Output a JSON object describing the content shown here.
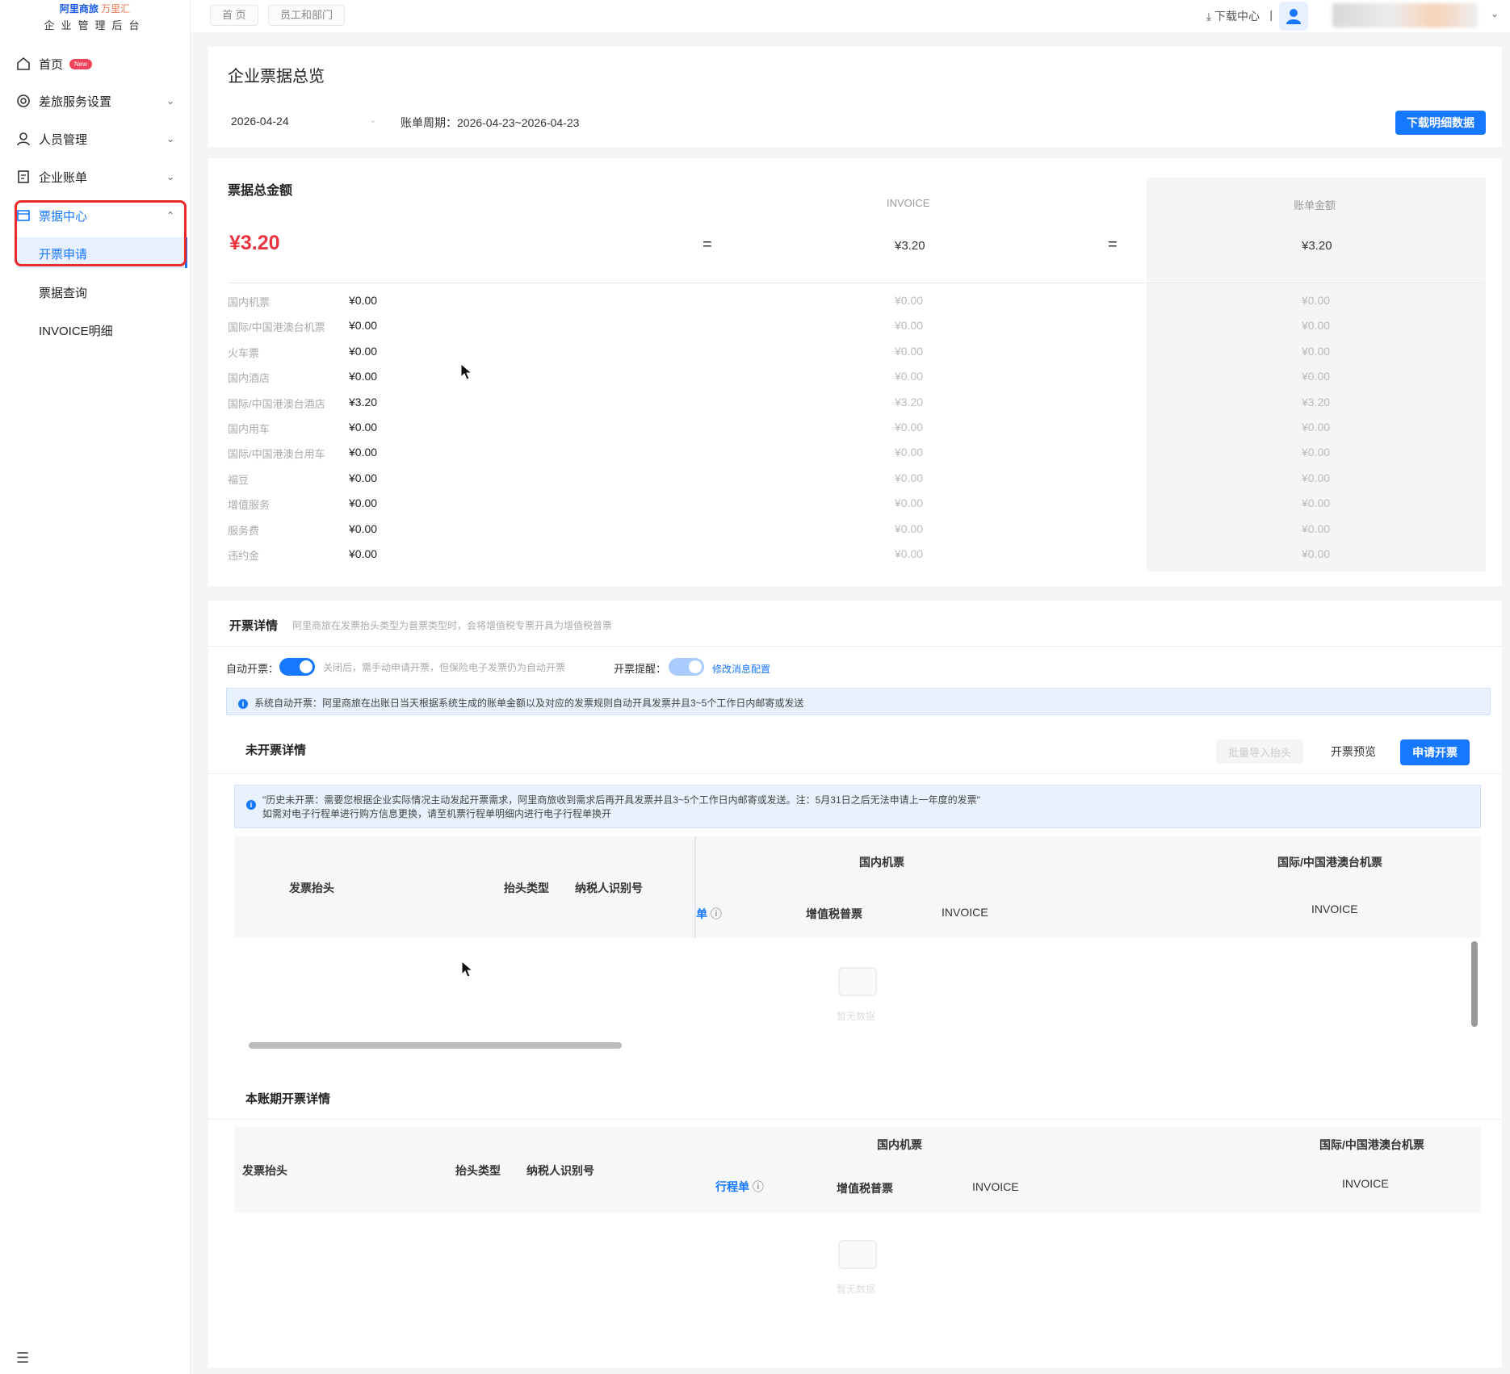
{
  "sidebar": {
    "brand_main": "阿里商旅",
    "brand_sub": "万里汇",
    "brand_subtitle": "企业管理后台",
    "home_label": "首页",
    "home_badge": "New",
    "items": [
      {
        "label": "差旅服务设置"
      },
      {
        "label": "人员管理"
      },
      {
        "label": "企业账单"
      },
      {
        "label": "票据中心"
      }
    ],
    "sub_items": [
      {
        "label": "开票申请"
      },
      {
        "label": "票据查询"
      },
      {
        "label": "INVOICE明细"
      }
    ]
  },
  "topbar": {
    "crumbs": [
      "首 页",
      "员工和部门"
    ],
    "download_center": "下载中心",
    "separator": "|"
  },
  "overview": {
    "title": "企业票据总览",
    "date": "2026-04-24",
    "period_label": "账单周期：",
    "period_value": "2026-04-23~2026-04-23",
    "download_btn": "下载明细数据"
  },
  "totals": {
    "section_title": "票据总金额",
    "total_amount": "¥3.20",
    "invoice_head": "INVOICE",
    "bill_head": "账单金额",
    "invoice_amount": "¥3.20",
    "bill_amount": "¥3.20",
    "equals": "=",
    "rows": [
      {
        "label": "国内机票",
        "amount": "¥0.00",
        "invoice": "¥0.00",
        "bill": "¥0.00"
      },
      {
        "label": "国际/中国港澳台机票",
        "amount": "¥0.00",
        "invoice": "¥0.00",
        "bill": "¥0.00"
      },
      {
        "label": "火车票",
        "amount": "¥0.00",
        "invoice": "¥0.00",
        "bill": "¥0.00"
      },
      {
        "label": "国内酒店",
        "amount": "¥0.00",
        "invoice": "¥0.00",
        "bill": "¥0.00"
      },
      {
        "label": "国际/中国港澳台酒店",
        "amount": "¥3.20",
        "invoice": "¥3.20",
        "bill": "¥3.20"
      },
      {
        "label": "国内用车",
        "amount": "¥0.00",
        "invoice": "¥0.00",
        "bill": "¥0.00"
      },
      {
        "label": "国际/中国港澳台用车",
        "amount": "¥0.00",
        "invoice": "¥0.00",
        "bill": "¥0.00"
      },
      {
        "label": "福豆",
        "amount": "¥0.00",
        "invoice": "¥0.00",
        "bill": "¥0.00"
      },
      {
        "label": "增值服务",
        "amount": "¥0.00",
        "invoice": "¥0.00",
        "bill": "¥0.00"
      },
      {
        "label": "服务费",
        "amount": "¥0.00",
        "invoice": "¥0.00",
        "bill": "¥0.00"
      },
      {
        "label": "违约金",
        "amount": "¥0.00",
        "invoice": "¥0.00",
        "bill": "¥0.00"
      }
    ]
  },
  "details": {
    "title": "开票详情",
    "title_hint": "阿里商旅在发票抬头类型为普票类型时，会将增值税专票开具为增值税普票",
    "auto_label": "自动开票：",
    "auto_hint": "关闭后，需手动申请开票，但保险电子发票仍为自动开票",
    "remind_label": "开票提醒：",
    "remind_link": "修改消息配置",
    "info": "系统自动开票：阿里商旅在出账日当天根据系统生成的账单金额以及对应的发票规则自动开具发票并且3~5个工作日内邮寄或发送"
  },
  "uninvoiced": {
    "title": "未开票详情",
    "btn_import": "批量导入抬头",
    "btn_preview": "开票预览",
    "btn_apply": "申请开票",
    "notice_line1": "\"历史未开票：需要您根据企业实际情况主动发起开票需求，阿里商旅收到需求后再开具发票并且3~5个工作日内邮寄或发送。注：5月31日之后无法申请上一年度的发票\"",
    "notice_line2": "如需对电子行程单进行购方信息更换，请至机票行程单明细内进行电子行程单换开",
    "col_header": "发票抬头",
    "col_type": "抬头类型",
    "col_tax": "纳税人识别号",
    "group_domestic": "国内机票",
    "group_intl": "国际/中国港澳台机票",
    "col_itinerary_partial": "单",
    "col_vat": "增值税普票",
    "col_invoice": "INVOICE",
    "col_invoice2": "INVOICE",
    "empty": "暂无数据"
  },
  "current": {
    "title": "本账期开票详情",
    "col_header": "发票抬头",
    "col_type": "抬头类型",
    "col_tax": "纳税人识别号",
    "group_domestic": "国内机票",
    "group_intl": "国际/中国港澳台机票",
    "col_itinerary": "行程单",
    "col_vat": "增值税普票",
    "col_invoice": "INVOICE",
    "col_invoice2": "INVOICE",
    "empty": "暂无数据"
  },
  "colors": {
    "accent": "#1677ff",
    "total_red": "#e8343f",
    "highlight": "#e82a2a"
  }
}
